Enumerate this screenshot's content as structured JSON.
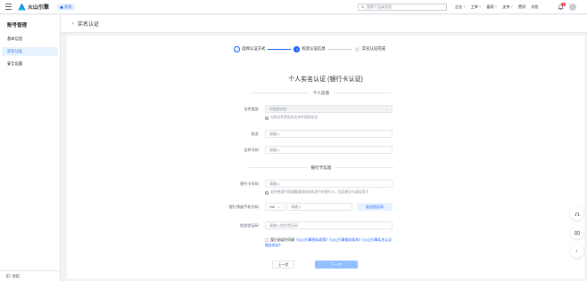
{
  "topbar": {
    "logo_text": "火山引擎",
    "home_label": "总览",
    "search_placeholder": "搜索产品或文档",
    "nav_items": [
      {
        "label": "企业",
        "has_menu": true
      },
      {
        "label": "工单",
        "has_menu": true
      },
      {
        "label": "备案",
        "has_menu": true
      },
      {
        "label": "支持",
        "has_menu": true
      },
      {
        "label": "费用",
        "has_menu": false
      },
      {
        "label": "文档",
        "has_menu": false
      }
    ],
    "notification_count": "1"
  },
  "sidebar": {
    "title": "账号管理",
    "items": [
      {
        "label": "基本信息",
        "active": false
      },
      {
        "label": "实名认证",
        "active": true
      },
      {
        "label": "安全设置",
        "active": false
      }
    ],
    "footer_label": "收起"
  },
  "header": {
    "title": "实名认证"
  },
  "steps": [
    {
      "number": "✓",
      "label": "选择认证方式",
      "state": "done"
    },
    {
      "number": "2",
      "label": "校验认证信息",
      "state": "current"
    },
    {
      "number": "3",
      "label": "实名认证完成",
      "state": "todo"
    }
  ],
  "form": {
    "title": "个人实名认证 (银行卡认证)",
    "personal_section": "个人信息",
    "id_type_label": "证件类型",
    "id_type_value": "中国身份证",
    "id_type_hint": "当前证件类型仅支持中国身份证",
    "name_label": "姓名",
    "name_placeholder": "请输入",
    "id_number_label": "证件号码",
    "id_number_placeholder": "请输入",
    "bank_section": "银行卡信息",
    "card_label": "银行卡号码",
    "card_placeholder": "请输入",
    "card_hint": "支持使用中国国籍或国际机构发行的银行卡，包括借记卡或信用卡",
    "phone_label": "银行预留手机号码",
    "phone_prefix": "+86",
    "phone_placeholder": "请输入",
    "send_code_label": "发送验证码",
    "code_label": "短信验证码",
    "code_placeholder": "请输入短信验证码",
    "agree_prefix": "我已阅读并同意",
    "agree_links": [
      "《火山引擎隐私政策》",
      "《火山引擎服务条款》",
      "《火山引擎实名认证服务协议》"
    ],
    "prev_label": "上一步",
    "next_label": "下一步"
  },
  "float_buttons": [
    {
      "icon": "headset-icon"
    },
    {
      "icon": "feedback-icon"
    },
    {
      "icon": "chevron-right-icon"
    }
  ],
  "colors": {
    "primary": "#165dff",
    "primary_light": "#e8f3ff",
    "disabled_primary": "#94bfff",
    "badge": "#f53f3f"
  }
}
